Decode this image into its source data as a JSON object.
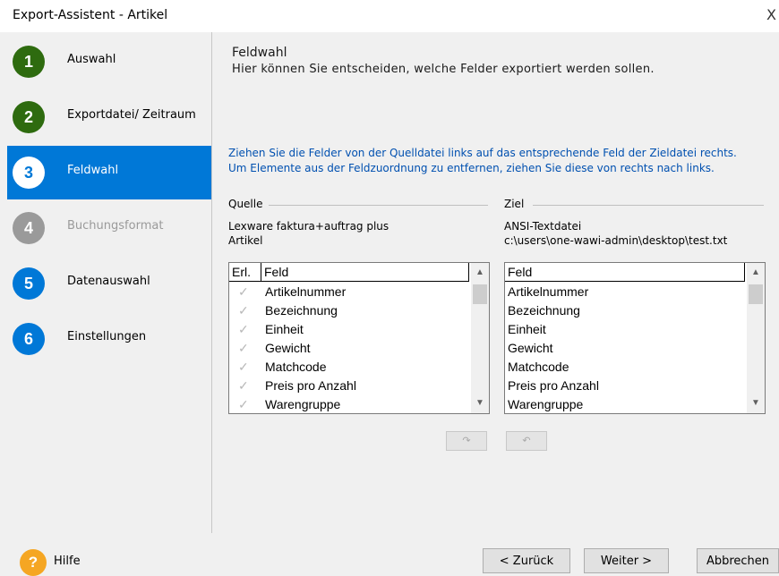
{
  "window": {
    "title": "Export-Assistent - Artikel",
    "close_glyph": "X"
  },
  "steps": [
    {
      "number": "1",
      "label": "Auswahl",
      "color": "#2e6b0f",
      "state": "done"
    },
    {
      "number": "2",
      "label": "Exportdatei/ Zeitraum",
      "color": "#2e6b0f",
      "state": "done"
    },
    {
      "number": "3",
      "label": "Feldwahl",
      "color": "#ffffff",
      "state": "active"
    },
    {
      "number": "4",
      "label": "Buchungsformat",
      "color": "#9a9a9a",
      "state": "disabled"
    },
    {
      "number": "5",
      "label": "Datenauswahl",
      "color": "#0078d7",
      "state": "pending"
    },
    {
      "number": "6",
      "label": "Einstellungen",
      "color": "#0078d7",
      "state": "pending"
    }
  ],
  "page": {
    "heading": "Feldwahl",
    "subheading": "Hier können Sie entscheiden, welche Felder exportiert werden sollen.",
    "instruction_1": "Ziehen Sie die Felder von der Quelldatei links auf das entsprechende Feld der Zieldatei rechts.",
    "instruction_2": "Um Elemente aus der Feldzuordnung zu entfernen, ziehen Sie diese von rechts nach links."
  },
  "source": {
    "group_label": "Quelle",
    "name": "Lexware faktura+auftrag plus",
    "type": "Artikel",
    "columns": {
      "done": "Erl.",
      "field": "Feld"
    },
    "fields": [
      "Artikelnummer",
      "Bezeichnung",
      "Einheit",
      "Gewicht",
      "Matchcode",
      "Preis pro Anzahl",
      "Warengruppe"
    ]
  },
  "target": {
    "group_label": "Ziel",
    "name": "ANSI-Textdatei",
    "path": "c:\\users\\one-wawi-admin\\desktop\\test.txt",
    "columns": {
      "field": "Feld"
    },
    "fields": [
      "Artikelnummer",
      "Bezeichnung",
      "Einheit",
      "Gewicht",
      "Matchcode",
      "Preis pro Anzahl",
      "Warengruppe"
    ]
  },
  "footer": {
    "help_glyph": "?",
    "help_label": "Hilfe",
    "back": "< Zurück",
    "next": "Weiter >",
    "cancel": "Abbrechen"
  },
  "colors": {
    "accent": "#0078d7",
    "done_green": "#2e6b0f",
    "help_orange": "#f5a623",
    "instruction_text": "#0050b0"
  }
}
